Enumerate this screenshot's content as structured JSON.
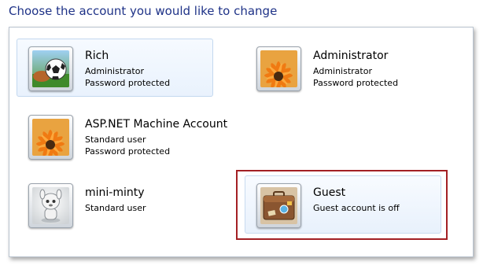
{
  "heading": "Choose the account you would like to change",
  "accounts": [
    {
      "name": "Rich",
      "line1": "Administrator",
      "line2": "Password protected",
      "picture": "soccer-ball-picture"
    },
    {
      "name": "Administrator",
      "line1": "Administrator",
      "line2": "Password protected",
      "picture": "orange-flower-picture"
    },
    {
      "name": "ASP.NET Machine Account",
      "line1": "Standard user",
      "line2": "Password protected",
      "picture": "orange-flower-picture"
    },
    {
      "name": "mini-minty",
      "line1": "Standard user",
      "line2": "",
      "picture": "robot-figure-picture"
    },
    {
      "name": "Guest",
      "line1": "Guest account is off",
      "line2": "",
      "picture": "suitcase-picture"
    }
  ],
  "colors": {
    "heading": "#1e3287",
    "selected_tile": "#e9f2fd",
    "highlight_border": "#a32024"
  }
}
